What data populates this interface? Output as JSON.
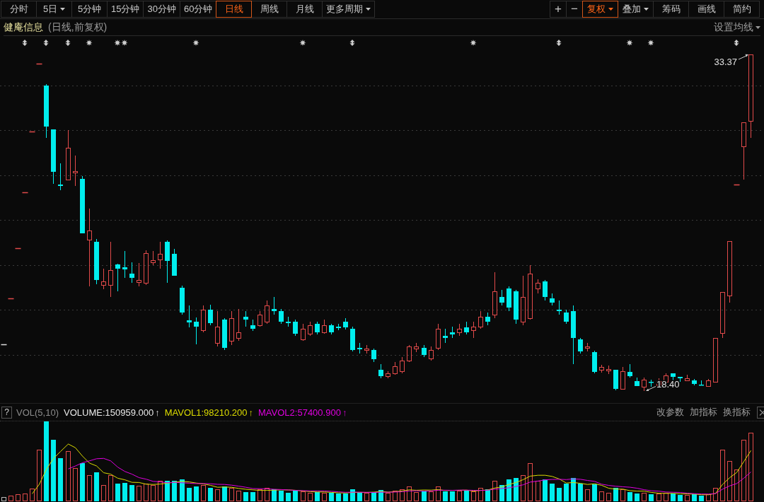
{
  "toolbar": {
    "periods": [
      {
        "label": "分时",
        "selected": false,
        "dropdown": false
      },
      {
        "label": "5日",
        "selected": false,
        "dropdown": true
      },
      {
        "label": "5分钟",
        "selected": false,
        "dropdown": false
      },
      {
        "label": "15分钟",
        "selected": false,
        "dropdown": false
      },
      {
        "label": "30分钟",
        "selected": false,
        "dropdown": false
      },
      {
        "label": "60分钟",
        "selected": false,
        "dropdown": false
      },
      {
        "label": "日线",
        "selected": true,
        "dropdown": false
      },
      {
        "label": "周线",
        "selected": false,
        "dropdown": false
      },
      {
        "label": "月线",
        "selected": false,
        "dropdown": false
      },
      {
        "label": "更多周期",
        "selected": false,
        "dropdown": true
      }
    ],
    "tools": [
      {
        "label": "+",
        "selected": false,
        "dropdown": false
      },
      {
        "label": "−",
        "selected": false,
        "dropdown": false
      },
      {
        "label": "复权",
        "selected": true,
        "dropdown": true
      },
      {
        "label": "叠加",
        "selected": false,
        "dropdown": true
      },
      {
        "label": "筹码",
        "selected": false,
        "dropdown": false
      },
      {
        "label": "画线",
        "selected": false,
        "dropdown": false
      },
      {
        "label": "简约",
        "selected": false,
        "dropdown": false
      }
    ]
  },
  "header": {
    "stock_name": "健庵信息",
    "subtitle": "(日线,前复权)",
    "ma_setting": {
      "label": "设置均线",
      "dropdown": true
    }
  },
  "price_chart": {
    "high_label": "33.37",
    "low_label": "18.40"
  },
  "volume_panel": {
    "help_label": "?",
    "name": "VOL(5,10)",
    "indicators": [
      {
        "text": "VOLUME:150959.000",
        "arrow": "↑",
        "color": "#e8e8e8"
      },
      {
        "text": "MAVOL1:98210.200",
        "arrow": "↑",
        "color": "#dcdc00"
      },
      {
        "text": "MAVOL2:57400.900",
        "arrow": "↑",
        "color": "#e000e0"
      }
    ],
    "actions": [
      "改参数",
      "加指标",
      "换指标"
    ]
  }
}
